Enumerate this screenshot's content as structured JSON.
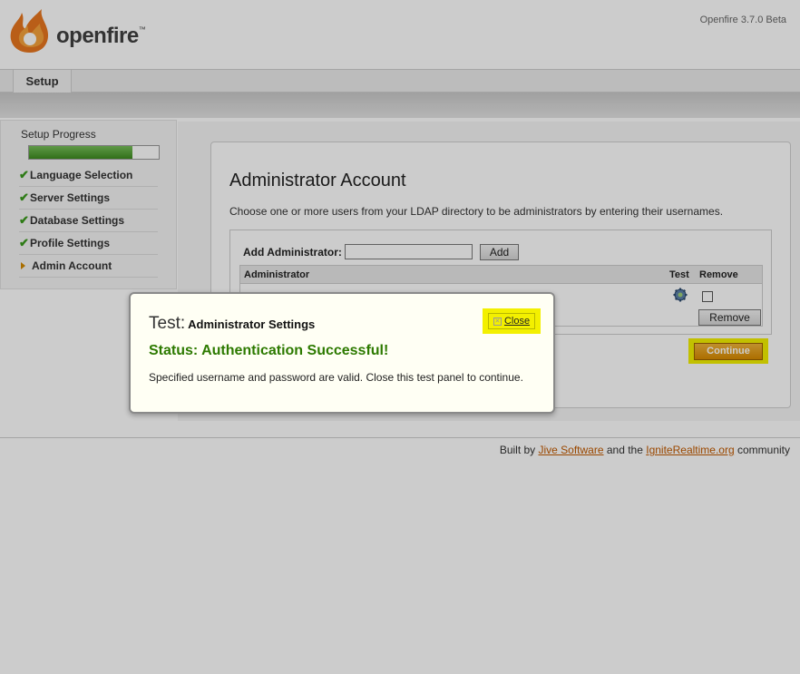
{
  "header": {
    "logo_text": "openfire",
    "logo_tm": "™",
    "version": "Openfire 3.7.0 Beta"
  },
  "tabs": [
    {
      "label": "Setup",
      "active": true
    }
  ],
  "sidebar": {
    "progress_label": "Setup Progress",
    "progress_fraction": 0.8,
    "steps": [
      {
        "label": "Language Selection",
        "status": "done"
      },
      {
        "label": "Server Settings",
        "status": "done"
      },
      {
        "label": "Database Settings",
        "status": "done"
      },
      {
        "label": "Profile Settings",
        "status": "done"
      },
      {
        "label": "Admin Account",
        "status": "current"
      }
    ]
  },
  "main": {
    "title": "Administrator Account",
    "description": "Choose one or more users from your LDAP directory to be administrators by entering their usernames.",
    "add_label": "Add Administrator:",
    "add_input_value": "",
    "add_button": "Add",
    "table": {
      "headers": {
        "administrator": "Administrator",
        "test": "Test",
        "remove": "Remove"
      },
      "rows": [
        {
          "username": "",
          "test_icon": "gear-icon",
          "remove_checked": false
        }
      ]
    },
    "remove_button": "Remove",
    "continue_button": "Continue"
  },
  "footer": {
    "prefix": "Built by ",
    "link1": "Jive Software",
    "middle": " and the ",
    "link2": "IgniteRealtime.org",
    "suffix": " community"
  },
  "dialog": {
    "title_big": "Test:",
    "title_small": "Administrator Settings",
    "close_label": "Close",
    "status": "Status: Authentication Successful!",
    "message": "Specified username and password are valid. Close this test panel to continue."
  },
  "colors": {
    "accent_orange": "#d88a00",
    "success_green": "#2d7a00",
    "highlight_yellow": "#f3f000",
    "link_color": "#c25a00"
  }
}
